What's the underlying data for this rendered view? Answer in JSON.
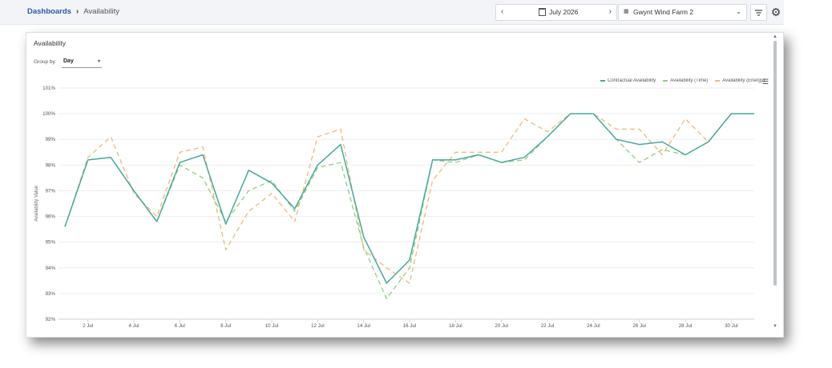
{
  "breadcrumb": {
    "root": "Dashboards",
    "separator": "›",
    "current": "Availability"
  },
  "date_picker": {
    "prev": "‹",
    "value": "July 2026",
    "next": "›"
  },
  "site_select": {
    "value": "Gwynt Wind Farm 2"
  },
  "panel": {
    "title": "Availability",
    "group_by_label": "Group by",
    "group_by_value": "Day"
  },
  "colors": {
    "contractual": "#4aa89b",
    "time": "#8fcf80",
    "energy": "#f0b87a"
  },
  "chart_data": {
    "type": "line",
    "title": "",
    "ylabel": "Availability Value",
    "xlabel": "",
    "ylim": [
      92,
      101
    ],
    "yticks": [
      "92%",
      "93%",
      "94%",
      "95%",
      "96%",
      "97%",
      "98%",
      "99%",
      "100%",
      "101%"
    ],
    "x": [
      1,
      2,
      3,
      4,
      5,
      6,
      7,
      8,
      9,
      10,
      11,
      12,
      13,
      14,
      15,
      16,
      17,
      18,
      19,
      20,
      21,
      22,
      23,
      24,
      25,
      26,
      27,
      28,
      29,
      30,
      31
    ],
    "xtick_labels": [
      "2 Jul",
      "4 Jul",
      "6 Jul",
      "8 Jul",
      "10 Jul",
      "12 Jul",
      "14 Jul",
      "16 Jul",
      "18 Jul",
      "20 Jul",
      "22 Jul",
      "24 Jul",
      "26 Jul",
      "28 Jul",
      "30 Jul"
    ],
    "xtick_values": [
      2,
      4,
      6,
      8,
      10,
      12,
      14,
      16,
      18,
      20,
      22,
      24,
      26,
      28,
      30
    ],
    "legend": "top-right",
    "series": [
      {
        "name": "Contractual Availability",
        "dash": false,
        "values": [
          95.6,
          98.2,
          98.3,
          97.0,
          95.8,
          98.1,
          98.4,
          95.7,
          97.8,
          97.3,
          96.3,
          98.0,
          98.8,
          95.2,
          93.4,
          94.3,
          98.2,
          98.2,
          98.4,
          98.1,
          98.3,
          99.1,
          100.0,
          100.0,
          99.0,
          98.8,
          98.9,
          98.4,
          98.9,
          100.0,
          100.0
        ]
      },
      {
        "name": "Availability (Time)",
        "dash": true,
        "values": [
          95.6,
          98.2,
          98.3,
          97.0,
          95.8,
          98.0,
          97.5,
          95.8,
          97.0,
          97.4,
          96.2,
          97.9,
          98.1,
          94.8,
          92.8,
          94.0,
          98.2,
          98.1,
          98.4,
          98.1,
          98.2,
          99.1,
          100.0,
          100.0,
          99.0,
          98.1,
          98.6,
          98.4,
          98.9,
          100.0,
          100.0
        ]
      },
      {
        "name": "Availability (Energy)",
        "dash": true,
        "values": [
          95.6,
          98.3,
          99.1,
          96.9,
          96.0,
          98.5,
          98.7,
          94.7,
          96.2,
          96.9,
          95.8,
          99.1,
          99.4,
          94.7,
          94.0,
          93.4,
          97.4,
          98.5,
          98.5,
          98.5,
          99.8,
          99.3,
          100.0,
          100.0,
          99.4,
          99.4,
          98.4,
          99.8,
          98.9,
          100.0,
          100.0
        ]
      }
    ]
  }
}
